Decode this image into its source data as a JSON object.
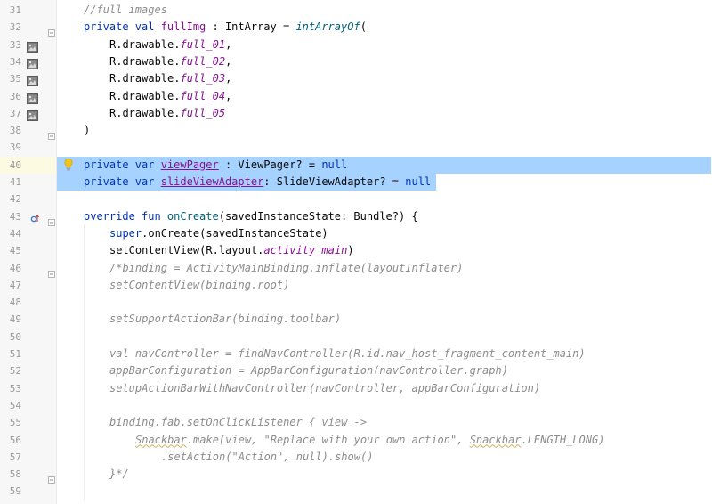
{
  "editor": {
    "lines": [
      {
        "num": "31",
        "tokens": [
          {
            "t": "//full images",
            "c": "cmt"
          }
        ]
      },
      {
        "num": "32",
        "tokens": [
          {
            "t": "private val ",
            "c": "kw"
          },
          {
            "t": "fullImg",
            "c": "prop"
          },
          {
            "t": " : IntArray = ",
            "c": ""
          },
          {
            "t": "intArrayOf",
            "c": "fn ital"
          },
          {
            "t": "(",
            "c": ""
          }
        ],
        "fold": true
      },
      {
        "num": "33",
        "indent": 1,
        "tokens": [
          {
            "t": "R.drawable.",
            "c": ""
          },
          {
            "t": "full_01",
            "c": "prop ital"
          },
          {
            "t": ",",
            "c": ""
          }
        ],
        "image_icon": true
      },
      {
        "num": "34",
        "indent": 1,
        "tokens": [
          {
            "t": "R.drawable.",
            "c": ""
          },
          {
            "t": "full_02",
            "c": "prop ital"
          },
          {
            "t": ",",
            "c": ""
          }
        ],
        "image_icon": true
      },
      {
        "num": "35",
        "indent": 1,
        "tokens": [
          {
            "t": "R.drawable.",
            "c": ""
          },
          {
            "t": "full_03",
            "c": "prop ital"
          },
          {
            "t": ",",
            "c": ""
          }
        ],
        "image_icon": true
      },
      {
        "num": "36",
        "indent": 1,
        "tokens": [
          {
            "t": "R.drawable.",
            "c": ""
          },
          {
            "t": "full_04",
            "c": "prop ital"
          },
          {
            "t": ",",
            "c": ""
          }
        ],
        "image_icon": true
      },
      {
        "num": "37",
        "indent": 1,
        "tokens": [
          {
            "t": "R.drawable.",
            "c": ""
          },
          {
            "t": "full_05",
            "c": "prop ital"
          }
        ],
        "image_icon": true
      },
      {
        "num": "38",
        "tokens": [
          {
            "t": ")",
            "c": ""
          }
        ],
        "fold": true
      },
      {
        "num": "39",
        "tokens": []
      },
      {
        "num": "40",
        "tokens": [
          {
            "t": "private var ",
            "c": "kw"
          },
          {
            "t": "viewPager",
            "c": "prop und"
          },
          {
            "t": " : ViewPager? = ",
            "c": ""
          },
          {
            "t": "null",
            "c": "kw"
          }
        ],
        "highlight": "full",
        "caret": true,
        "bulb": true
      },
      {
        "num": "41",
        "tokens": [
          {
            "t": "private var ",
            "c": "kw"
          },
          {
            "t": "slideViewAdapter",
            "c": "prop und"
          },
          {
            "t": ": SlideViewAdapter? = ",
            "c": ""
          },
          {
            "t": "null",
            "c": "kw"
          }
        ],
        "highlight": "partial"
      },
      {
        "num": "42",
        "tokens": []
      },
      {
        "num": "43",
        "tokens": [
          {
            "t": "override fun ",
            "c": "kw"
          },
          {
            "t": "onCreate",
            "c": "fn"
          },
          {
            "t": "(savedInstanceState: Bundle?) {",
            "c": ""
          }
        ],
        "fold": true,
        "override_icon": true
      },
      {
        "num": "44",
        "indent": 1,
        "tokens": [
          {
            "t": "super",
            "c": "kw"
          },
          {
            "t": ".onCreate(savedInstanceState)",
            "c": ""
          }
        ]
      },
      {
        "num": "45",
        "indent": 1,
        "tokens": [
          {
            "t": "setContentView(R.layout.",
            "c": ""
          },
          {
            "t": "activity_main",
            "c": "prop ital"
          },
          {
            "t": ")",
            "c": ""
          }
        ]
      },
      {
        "num": "46",
        "indent": 1,
        "tokens": [
          {
            "t": "/*binding = ActivityMainBinding.inflate(layoutInflater)",
            "c": "cmt"
          }
        ],
        "fold": true
      },
      {
        "num": "47",
        "indent": 1,
        "tokens": [
          {
            "t": "setContentView(binding.root)",
            "c": "cmt"
          }
        ]
      },
      {
        "num": "48",
        "tokens": []
      },
      {
        "num": "49",
        "indent": 1,
        "tokens": [
          {
            "t": "setSupportActionBar(binding.toolbar)",
            "c": "cmt"
          }
        ]
      },
      {
        "num": "50",
        "tokens": []
      },
      {
        "num": "51",
        "indent": 1,
        "tokens": [
          {
            "t": "val navController = findNavController(R.id.nav_host_fragment_content_main)",
            "c": "cmt"
          }
        ]
      },
      {
        "num": "52",
        "indent": 1,
        "tokens": [
          {
            "t": "appBarConfiguration = AppBarConfiguration(navController.graph)",
            "c": "cmt"
          }
        ]
      },
      {
        "num": "53",
        "indent": 1,
        "tokens": [
          {
            "t": "setupActionBarWithNavController(navController, appBarConfiguration)",
            "c": "cmt"
          }
        ]
      },
      {
        "num": "54",
        "tokens": []
      },
      {
        "num": "55",
        "indent": 1,
        "tokens": [
          {
            "t": "binding.fab.setOnClickListener { view ->",
            "c": "cmt"
          }
        ]
      },
      {
        "num": "56",
        "indent": 2,
        "tokens": [
          {
            "t": "Snackbar",
            "c": "cmt warn"
          },
          {
            "t": ".make(view, \"Replace with your own action\", ",
            "c": "cmt"
          },
          {
            "t": "Snackbar",
            "c": "cmt warn"
          },
          {
            "t": ".LENGTH_LONG)",
            "c": "cmt"
          }
        ]
      },
      {
        "num": "57",
        "indent": 3,
        "tokens": [
          {
            "t": ".setAction(\"Action\", null).show()",
            "c": "cmt"
          }
        ]
      },
      {
        "num": "58",
        "indent": 1,
        "tokens": [
          {
            "t": "}*/",
            "c": "cmt"
          }
        ],
        "fold": true
      },
      {
        "num": "59",
        "tokens": []
      }
    ],
    "colors": {
      "keyword": "#0033b3",
      "property": "#871094",
      "function": "#00627a",
      "comment": "#8c8c8c",
      "selection": "#a6d2ff",
      "caret_line_gutter": "#fcfae1"
    },
    "icons": {
      "image_icon": "image-thumbnail-icon",
      "fold": "fold-marker-icon",
      "bulb": "intention-bulb-icon",
      "override": "override-method-icon"
    }
  }
}
